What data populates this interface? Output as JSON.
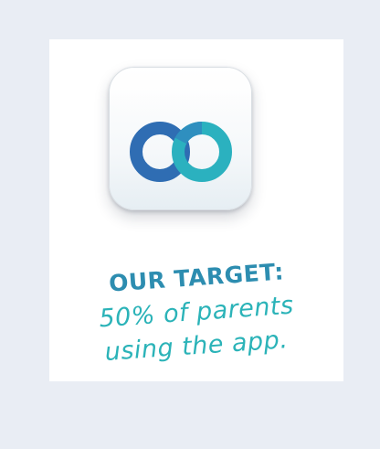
{
  "poster": {
    "app_icon": "infinity-logo-icon",
    "headline": "OUR TARGET:",
    "line1": "50% of parents",
    "line2": "using the app."
  },
  "colors": {
    "background": "#e9edf4",
    "card": "#ffffff",
    "headline": "#2d8db0",
    "script": "#2bb3b8",
    "logo_dark": "#2f6db3",
    "logo_light": "#2bb1bf"
  }
}
